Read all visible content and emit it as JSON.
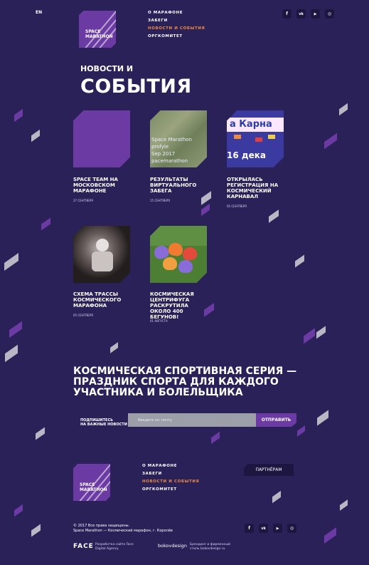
{
  "header": {
    "lang": "EN",
    "logo_text_1": "SPACE",
    "logo_text_2": "MARATHON",
    "nav": [
      "О МАРАФОНЕ",
      "ЗАБЕГИ",
      "НОВОСТИ И СОБЫТИЯ",
      "ОРГКОМИТЕТ"
    ],
    "social": [
      "f",
      "vk",
      "▶",
      "◎"
    ]
  },
  "page": {
    "title_small": "НОВОСТИ И",
    "title_big": "СОБЫТИЯ"
  },
  "cards": [
    {
      "title": "SPACE TEAM НА МОСКОВСКОМ МАРАФОНЕ",
      "date": "27 СЕНТЯБРЯ"
    },
    {
      "title": "РЕЗУЛЬТАТЫ ВИРТУАЛЬНОГО ЗАБЕГА",
      "date": "15 СЕНТЯБРЯ",
      "img_text": "Space Marathon\nprofyle\nSep 2017\npacemarathon"
    },
    {
      "title": "ОТКРЫЛАСЬ РЕГИСТРАЦИЯ НА КОСМИЧЕСКИЙ КАРНАВАЛ",
      "date": "05 СЕНТЯБРЯ",
      "img_text_1": "а Карна",
      "img_text_2": "16 дека"
    },
    {
      "title": "СХЕМА ТРАССЫ КОСМИЧЕСКОГО МАРАФОНА",
      "date": "05 СЕНТЯБРЯ"
    },
    {
      "title": "КОСМИЧЕСКАЯ ЦЕНТРИФУГА РАСКРУТИЛА ОКОЛО 400 БЕГУНОВ!",
      "date": "01 АВГУСТА"
    }
  ],
  "slogan": "КОСМИЧЕСКАЯ СПОРТИВНАЯ СЕРИЯ — ПРАЗДНИК СПОРТА ДЛЯ КАЖДОГО УЧАСТНИКА И БОЛЕЛЬЩИКА",
  "subscribe": {
    "label": "ПОДПИШИТЕСЬ\nНА ВАЖНЫЕ НОВОСТИ",
    "placeholder": "Введите эл. почту",
    "button": "ОТПРАВИТЬ"
  },
  "footer": {
    "logo_text_1": "SPACE",
    "logo_text_2": "MARATHON",
    "nav": [
      "О МАРАФОНЕ",
      "ЗАБЕГИ",
      "НОВОСТИ И СОБЫТИЯ",
      "ОРГКОМИТЕТ"
    ],
    "partners": "ПАРТНЁРАМ",
    "copyright_1": "© 2017 Все права защищены.",
    "copyright_2": "Space Marathon — Космический марафон, г. Королёв",
    "face": "FACE",
    "face_text": "Разработка сайта Face\nDigital Agency",
    "boko": "bokovdesign",
    "boko_text": "Брендинг и фирменный\nстиль bokovdesign.ru",
    "social": [
      "f",
      "vk",
      "▶",
      "◎"
    ]
  },
  "colors": {
    "bg": "#2a2158",
    "accent": "#6b3aa3",
    "active": "#f08a3c"
  }
}
